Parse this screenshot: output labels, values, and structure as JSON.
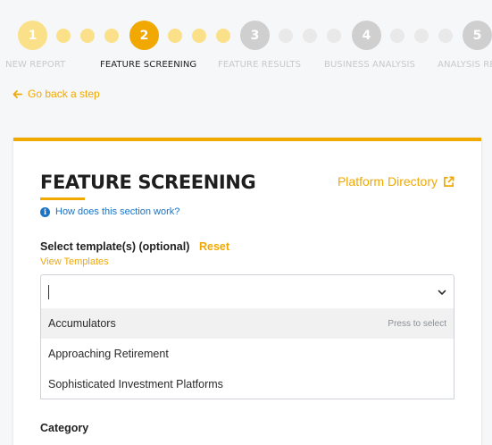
{
  "stepper": {
    "steps": [
      {
        "number": "1",
        "label": "NEW REPORT",
        "state": "done"
      },
      {
        "number": "2",
        "label": "FEATURE SCREENING",
        "state": "current"
      },
      {
        "number": "3",
        "label": "FEATURE RESULTS",
        "state": "upcoming"
      },
      {
        "number": "4",
        "label": "BUSINESS ANALYSIS",
        "state": "upcoming"
      },
      {
        "number": "5",
        "label": "ANALYSIS RES",
        "state": "upcoming"
      }
    ]
  },
  "nav": {
    "back_label": "Go back a step"
  },
  "card": {
    "title": "FEATURE SCREENING",
    "platform_directory": "Platform Directory",
    "help_link": "How does this section work?",
    "select_label": "Select template(s) (optional)",
    "reset_label": "Reset",
    "view_templates": "View Templates",
    "combo_value": "",
    "options": [
      {
        "label": "Accumulators",
        "hint": "Press to select"
      },
      {
        "label": "Approaching Retirement",
        "hint": ""
      },
      {
        "label": "Sophisticated Investment Platforms",
        "hint": ""
      }
    ],
    "category_label": "Category"
  },
  "colors": {
    "accent": "#f1a800",
    "accent_light": "#fbe08a",
    "inactive": "#cfcfcf",
    "inactive_light": "#e9e9e9",
    "link_blue": "#1a73c7"
  },
  "icons": [
    "arrow-left-icon",
    "external-link-icon",
    "info-icon",
    "chevron-down-icon"
  ]
}
